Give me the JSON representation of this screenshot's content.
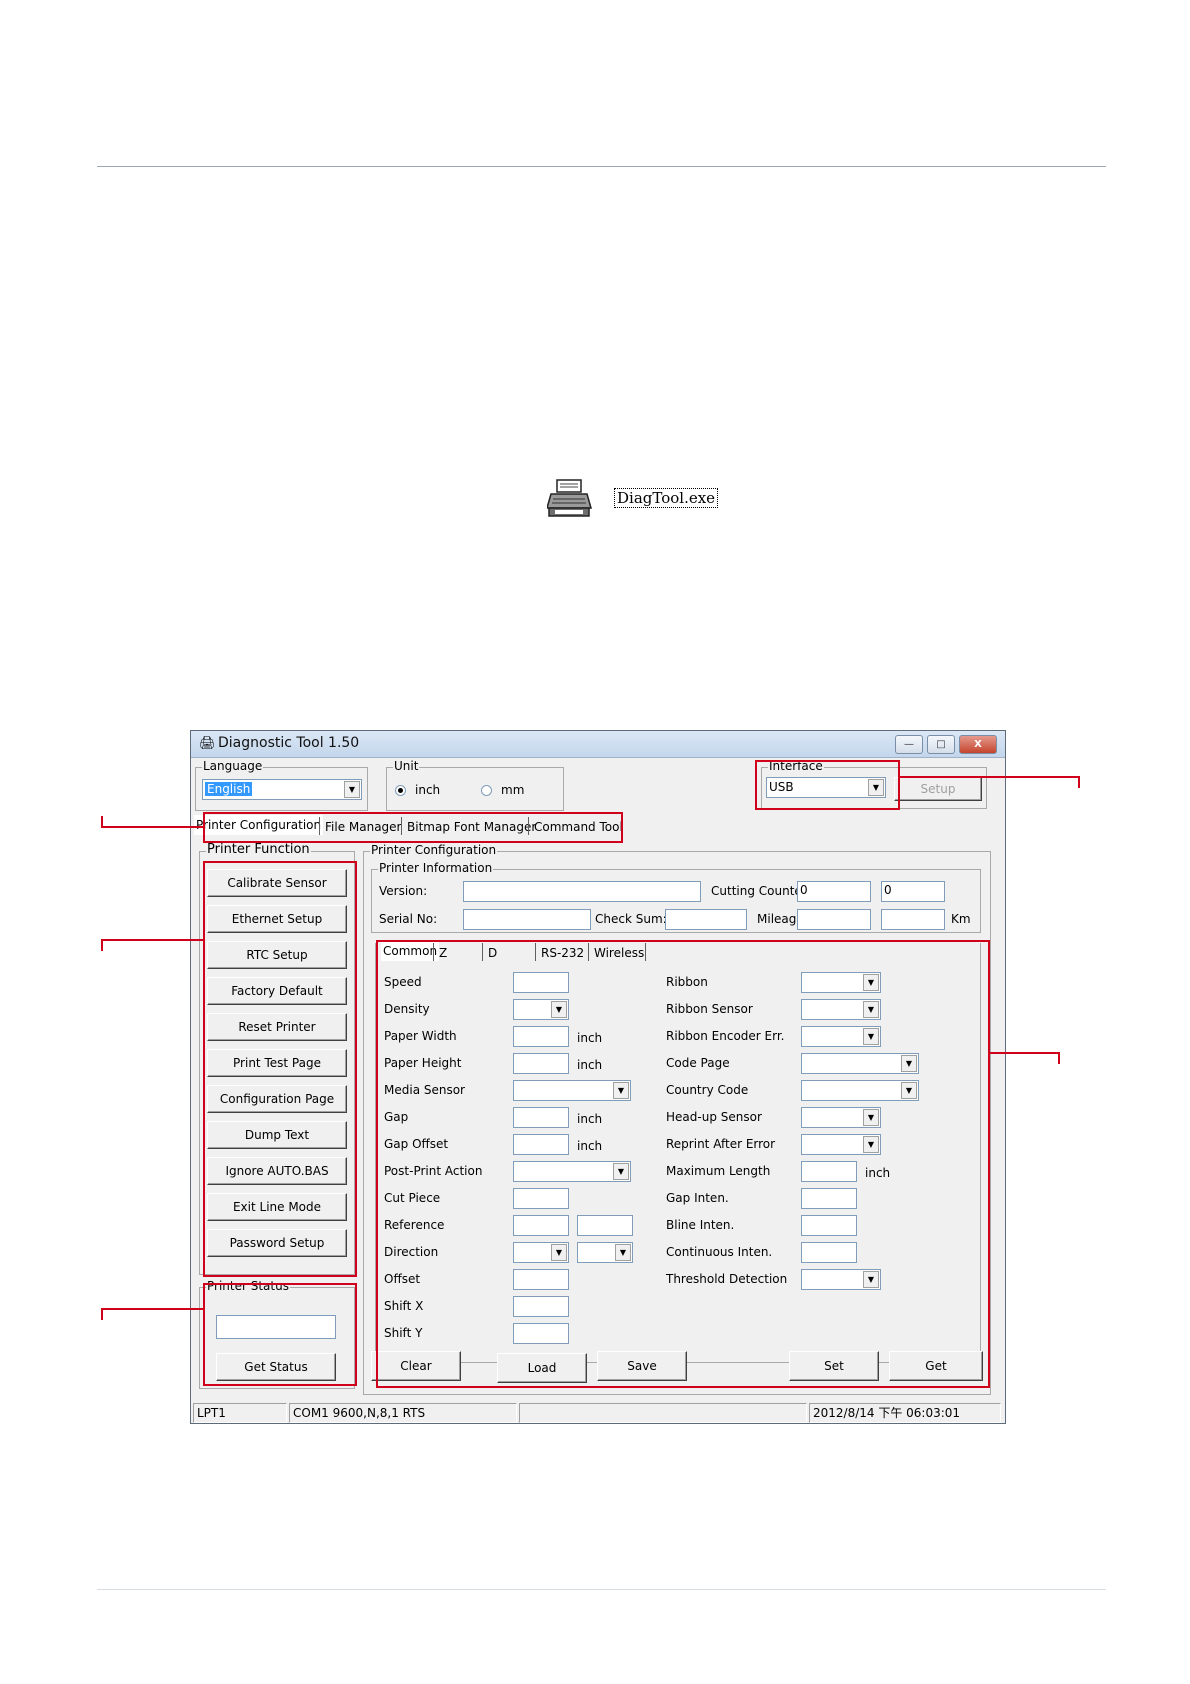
{
  "icon": {
    "label": "DiagTool.exe"
  },
  "window": {
    "title": "Diagnostic Tool 1.50",
    "controls": {
      "minimize": "—",
      "maximize": "□",
      "close": "X"
    },
    "language": {
      "label": "Language",
      "value": "English"
    },
    "unit": {
      "label": "Unit",
      "options": [
        "inch",
        "mm"
      ],
      "selected": "inch"
    },
    "interface": {
      "label": "Interface",
      "value": "USB",
      "setup_label": "Setup"
    },
    "tabs": [
      "Printer Configuration",
      "File Manager",
      "Bitmap Font Manager",
      "Command Tool"
    ],
    "printer_function": {
      "label": "Printer Function",
      "buttons": [
        "Calibrate Sensor",
        "Ethernet Setup",
        "RTC Setup",
        "Factory Default",
        "Reset Printer",
        "Print Test Page",
        "Configuration Page",
        "Dump Text",
        "Ignore AUTO.BAS",
        "Exit Line Mode",
        "Password Setup"
      ]
    },
    "printer_status": {
      "label": "Printer Status",
      "value": "",
      "button": "Get Status"
    },
    "printer_configuration": {
      "label": "Printer Configuration",
      "info": {
        "label": "Printer Information",
        "version_label": "Version:",
        "cutting_counter_label": "Cutting Counter:",
        "cutting_counter_1": "0",
        "cutting_counter_2": "0",
        "serial_label": "Serial No:",
        "checksum_label": "Check Sum:",
        "mileage_label": "Mileage:",
        "mileage_unit": "Km"
      },
      "subtabs": [
        "Common",
        "Z",
        "D",
        "RS-232",
        "Wireless"
      ],
      "left_fields": [
        "Speed",
        "Density",
        "Paper Width",
        "Paper Height",
        "Media Sensor",
        "Gap",
        "Gap Offset",
        "Post-Print Action",
        "Cut Piece",
        "Reference",
        "Direction",
        "Offset",
        "Shift X",
        "Shift Y"
      ],
      "right_fields": [
        "Ribbon",
        "Ribbon Sensor",
        "Ribbon Encoder Err.",
        "Code Page",
        "Country Code",
        "Head-up Sensor",
        "Reprint After Error",
        "Maximum Length",
        "Gap Inten.",
        "Bline Inten.",
        "Continuous Inten.",
        "Threshold Detection"
      ],
      "unit_inch": "inch",
      "actions": [
        "Clear",
        "Load",
        "Save",
        "Set",
        "Get"
      ]
    },
    "statusbar": {
      "port": "LPT1",
      "com": "COM1 9600,N,8,1 RTS",
      "blank": "",
      "datetime": "2012/8/14 下午 06:03:01"
    }
  }
}
